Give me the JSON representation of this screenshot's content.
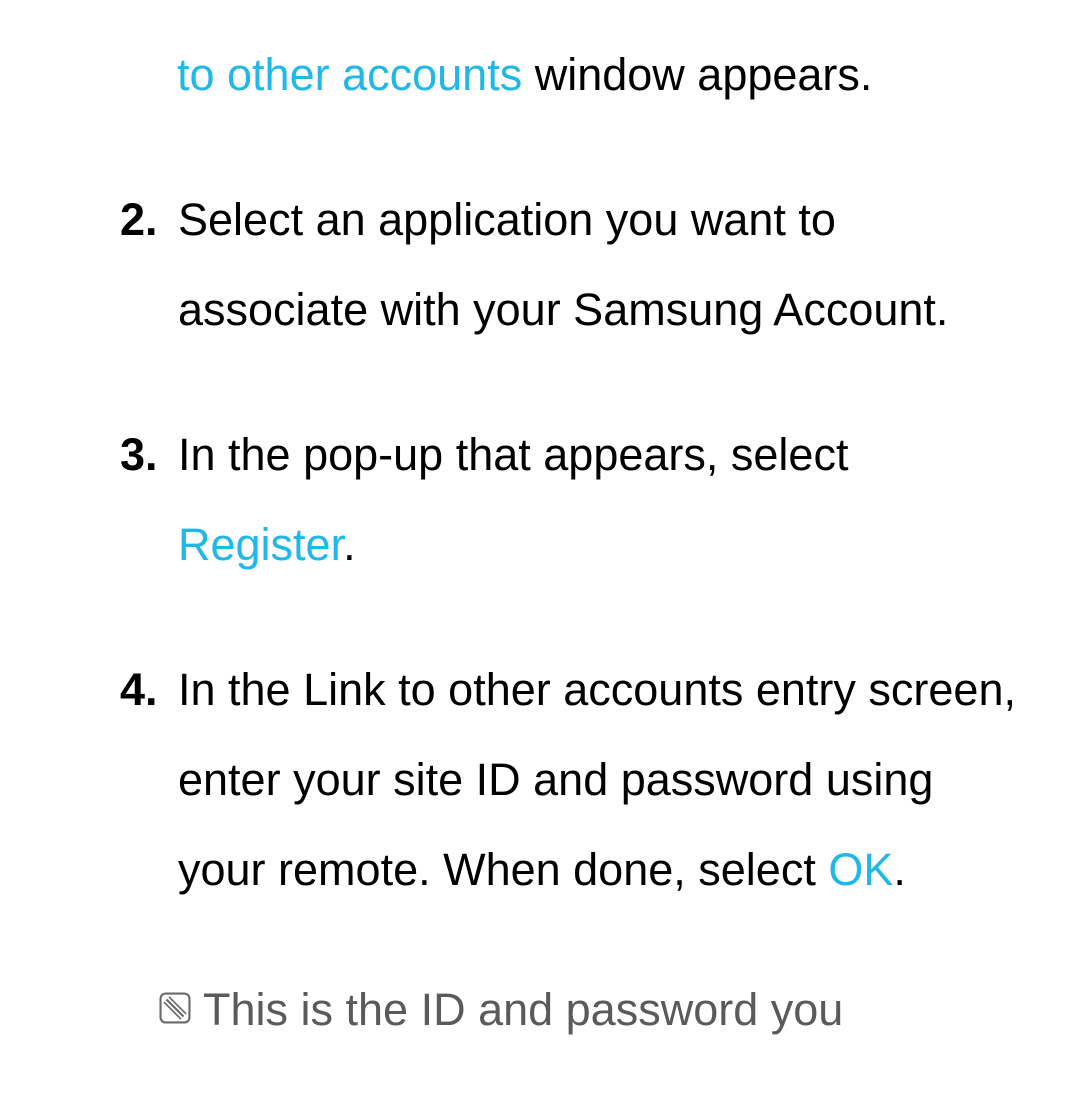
{
  "fragment": {
    "link": "to other accounts",
    "rest": " window appears."
  },
  "steps": [
    {
      "num": "2.",
      "text": "Select an application you want to associate with your Samsung Account."
    },
    {
      "num": "3.",
      "pre": "In the pop-up that appears, select ",
      "link": "Register",
      "post": "."
    },
    {
      "num": "4.",
      "pre": "In the Link to other accounts entry screen, enter your site ID and password using your remote. When done, select ",
      "link": "OK",
      "post": "."
    }
  ],
  "note": {
    "text": "This is the ID and password you"
  }
}
